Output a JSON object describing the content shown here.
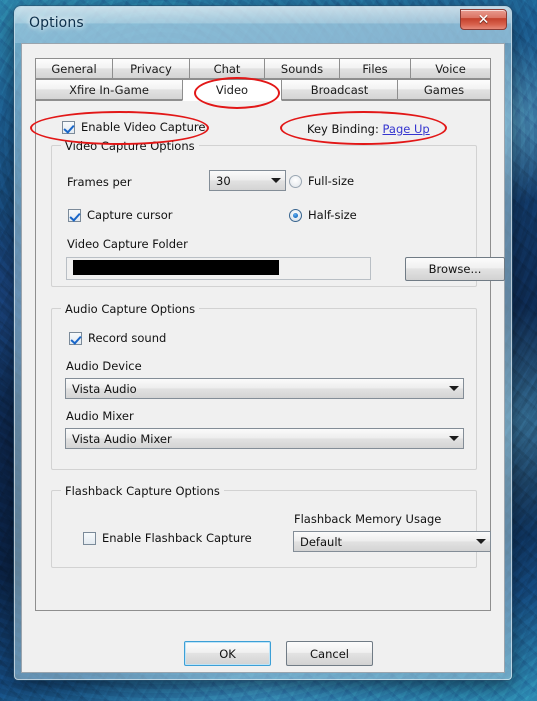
{
  "window": {
    "title": "Options",
    "close_label": "✕"
  },
  "tabs": {
    "row1": [
      {
        "label": "General",
        "selected": false
      },
      {
        "label": "Privacy",
        "selected": false
      },
      {
        "label": "Chat",
        "selected": false
      },
      {
        "label": "Sounds",
        "selected": false
      },
      {
        "label": "Files",
        "selected": false
      },
      {
        "label": "Voice",
        "selected": false
      }
    ],
    "row2": [
      {
        "label": "Xfire In-Game",
        "selected": false
      },
      {
        "label": "Video",
        "selected": true
      },
      {
        "label": "Broadcast",
        "selected": false
      },
      {
        "label": "Games",
        "selected": false
      }
    ]
  },
  "video": {
    "enable_capture_label": "Enable Video Capture",
    "enable_capture_checked": true,
    "key_binding_label": "Key Binding:",
    "key_binding_value": "Page Up",
    "capture_options": {
      "caption": "Video Capture Options",
      "frames_per_label": "Frames per",
      "frames_per_value": "30",
      "capture_cursor_label": "Capture cursor",
      "capture_cursor_checked": true,
      "full_size_label": "Full-size",
      "full_size_selected": false,
      "half_size_label": "Half-size",
      "half_size_selected": true,
      "folder_label": "Video Capture Folder",
      "folder_value": "",
      "browse_label": "Browse..."
    },
    "audio_options": {
      "caption": "Audio Capture Options",
      "record_sound_label": "Record sound",
      "record_sound_checked": true,
      "device_label": "Audio Device",
      "device_value": "Vista Audio",
      "mixer_label": "Audio Mixer",
      "mixer_value": "Vista Audio Mixer"
    },
    "flashback_options": {
      "caption": "Flashback Capture Options",
      "enable_label": "Enable Flashback Capture",
      "enable_checked": false,
      "memory_usage_label": "Flashback Memory Usage",
      "memory_usage_value": "Default"
    }
  },
  "footer": {
    "ok_label": "OK",
    "cancel_label": "Cancel"
  },
  "colors": {
    "accent": "#3535cf",
    "annotation": "#e21717",
    "close_button": "#c33f2b"
  }
}
